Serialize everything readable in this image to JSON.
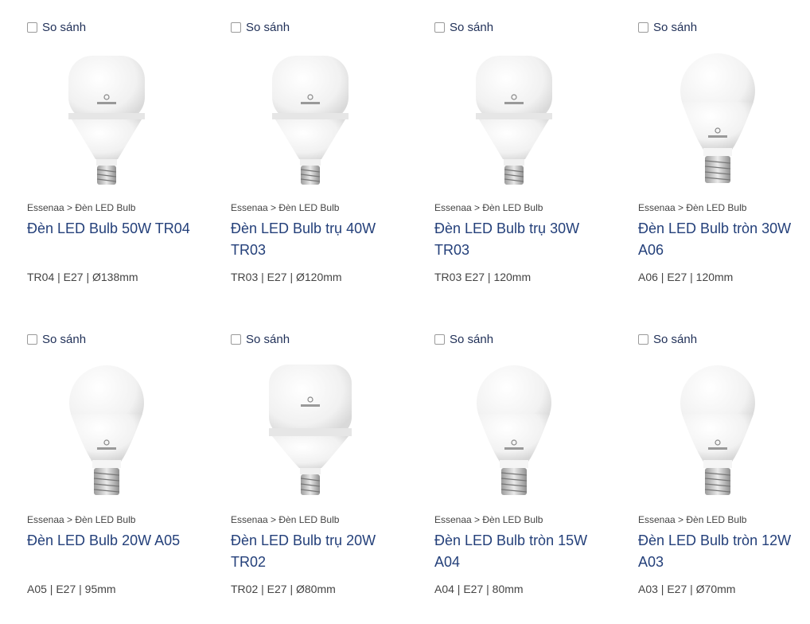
{
  "products": [
    {
      "compare_label": "So sánh",
      "icon": "tr-bulb-icon",
      "breadcrumb": "Essenaa > Đèn LED Bulb",
      "title": "Đèn LED Bulb 50W TR04",
      "specs": "TR04 | E27 | Ø138mm"
    },
    {
      "compare_label": "So sánh",
      "icon": "tr-bulb-icon",
      "breadcrumb": "Essenaa > Đèn LED Bulb",
      "title": "Đèn LED Bulb trụ 40W TR03",
      "specs": "TR03 | E27 | Ø120mm"
    },
    {
      "compare_label": "So sánh",
      "icon": "tr-bulb-icon",
      "breadcrumb": "Essenaa > Đèn LED Bulb",
      "title": "Đèn LED Bulb trụ 30W TR03",
      "specs": "TR03 E27 | 120mm"
    },
    {
      "compare_label": "So sánh",
      "icon": "a-bulb-icon",
      "breadcrumb": "Essenaa > Đèn LED Bulb",
      "title": "Đèn LED Bulb tròn 30W A06",
      "specs": "A06 | E27 | 120mm"
    },
    {
      "compare_label": "So sánh",
      "icon": "a-bulb-icon",
      "breadcrumb": "Essenaa > Đèn LED Bulb",
      "title": "Đèn LED Bulb 20W A05",
      "specs": "A05 | E27 | 95mm"
    },
    {
      "compare_label": "So sánh",
      "icon": "tr-bulb-icon",
      "breadcrumb": "Essenaa > Đèn LED Bulb",
      "title": "Đèn LED Bulb trụ 20W TR02",
      "specs": "TR02 | E27 | Ø80mm"
    },
    {
      "compare_label": "So sánh",
      "icon": "a-bulb-icon",
      "breadcrumb": "Essenaa > Đèn LED Bulb",
      "title": "Đèn LED Bulb tròn 15W A04",
      "specs": "A04 | E27 | 80mm"
    },
    {
      "compare_label": "So sánh",
      "icon": "a-bulb-icon",
      "breadcrumb": "Essenaa > Đèn LED Bulb",
      "title": "Đèn LED Bulb tròn 12W A03",
      "specs": "A03 | E27 | Ø70mm"
    }
  ],
  "colors": {
    "title": "#24407a",
    "compare": "#1f2f57",
    "text": "#444444"
  }
}
